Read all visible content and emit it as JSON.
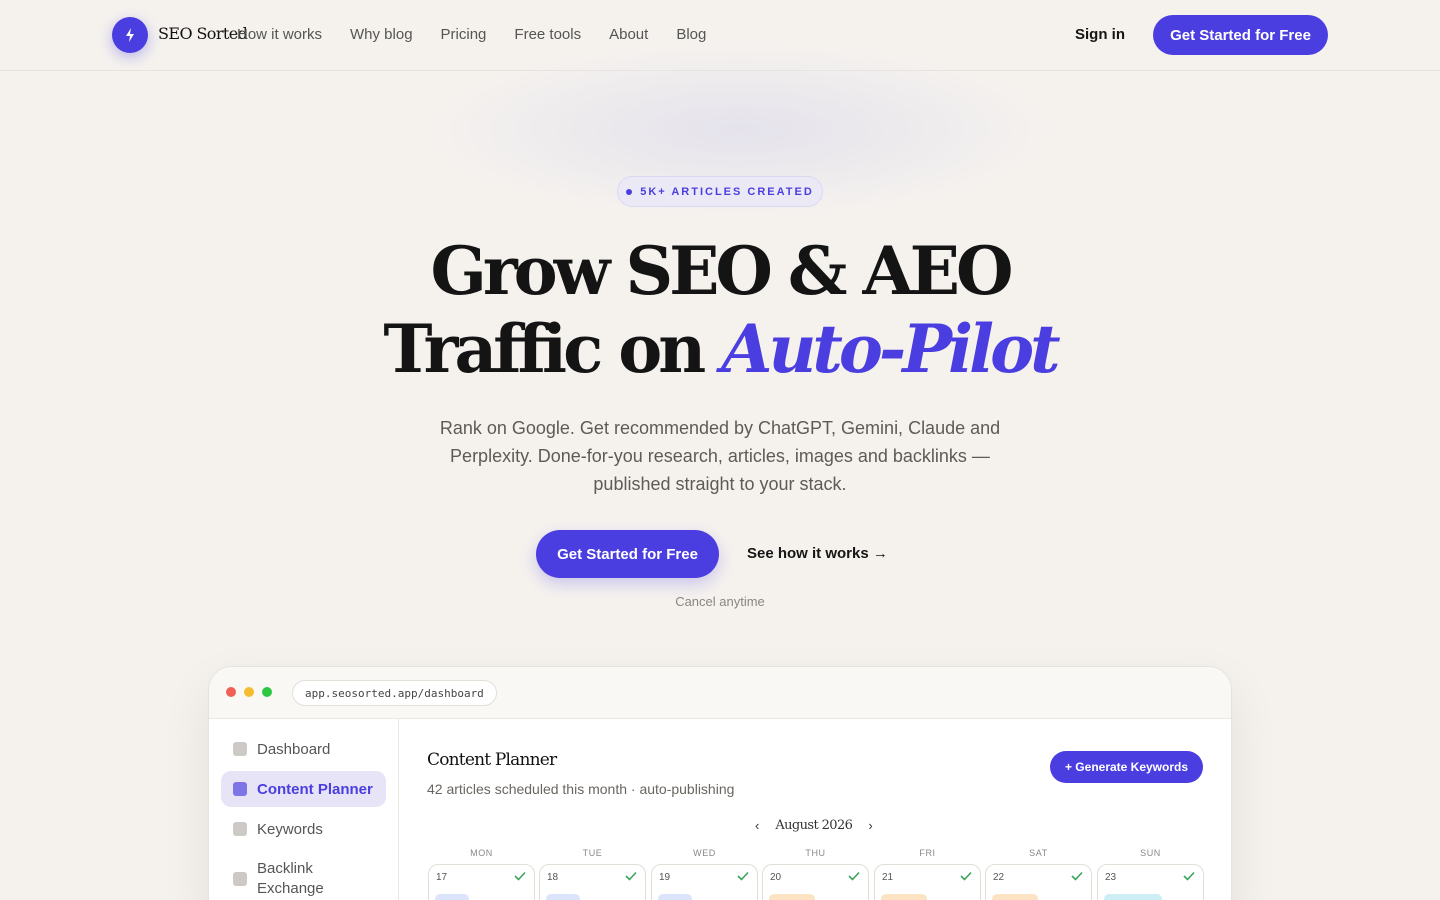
{
  "header": {
    "brand": "SEO Sorted",
    "nav": [
      "How it works",
      "Why blog",
      "Pricing",
      "Free tools",
      "About",
      "Blog"
    ],
    "sign_in": "Sign in",
    "cta": "Get Started for Free"
  },
  "hero": {
    "badge": "5K+ ARTICLES CREATED",
    "headline_line1": "Grow SEO & AEO",
    "headline_line2_plain": "Traffic on ",
    "headline_line2_accent": "Auto-Pilot",
    "subtext": "Rank on Google. Get recommended by ChatGPT, Gemini, Claude and Perplexity. Done-for-you research, articles, images and backlinks — published straight to your stack.",
    "cta": "Get Started for Free",
    "secondary_cta": "See how it works →",
    "note": "Cancel anytime"
  },
  "app": {
    "url": "app.seosorted.app/dashboard",
    "sidebar": [
      "Dashboard",
      "Content Planner",
      "Keywords",
      "Backlink Exchange"
    ],
    "active_item": "Content Planner",
    "title": "Content Planner",
    "subtitle": "42 articles scheduled this month · auto-publishing",
    "generate_button": "+ Generate Keywords",
    "month": "August 2026",
    "prev": "‹",
    "next": "›",
    "weekdays": [
      "MON",
      "TUE",
      "WED",
      "THU",
      "FRI",
      "SAT",
      "SUN"
    ],
    "days": [
      "17",
      "18",
      "19",
      "20",
      "21",
      "22",
      "23"
    ]
  },
  "colors": {
    "accent": "#4b3ee0",
    "background": "#f5f2ee",
    "chip_blue": "#dbe4fb",
    "chip_orange": "#fbe3c4",
    "chip_cyan": "#cdeef5",
    "check_green": "#3aa55a"
  },
  "icons": {
    "logo": "lightning-bolt-icon",
    "day_status": "check-icon"
  }
}
